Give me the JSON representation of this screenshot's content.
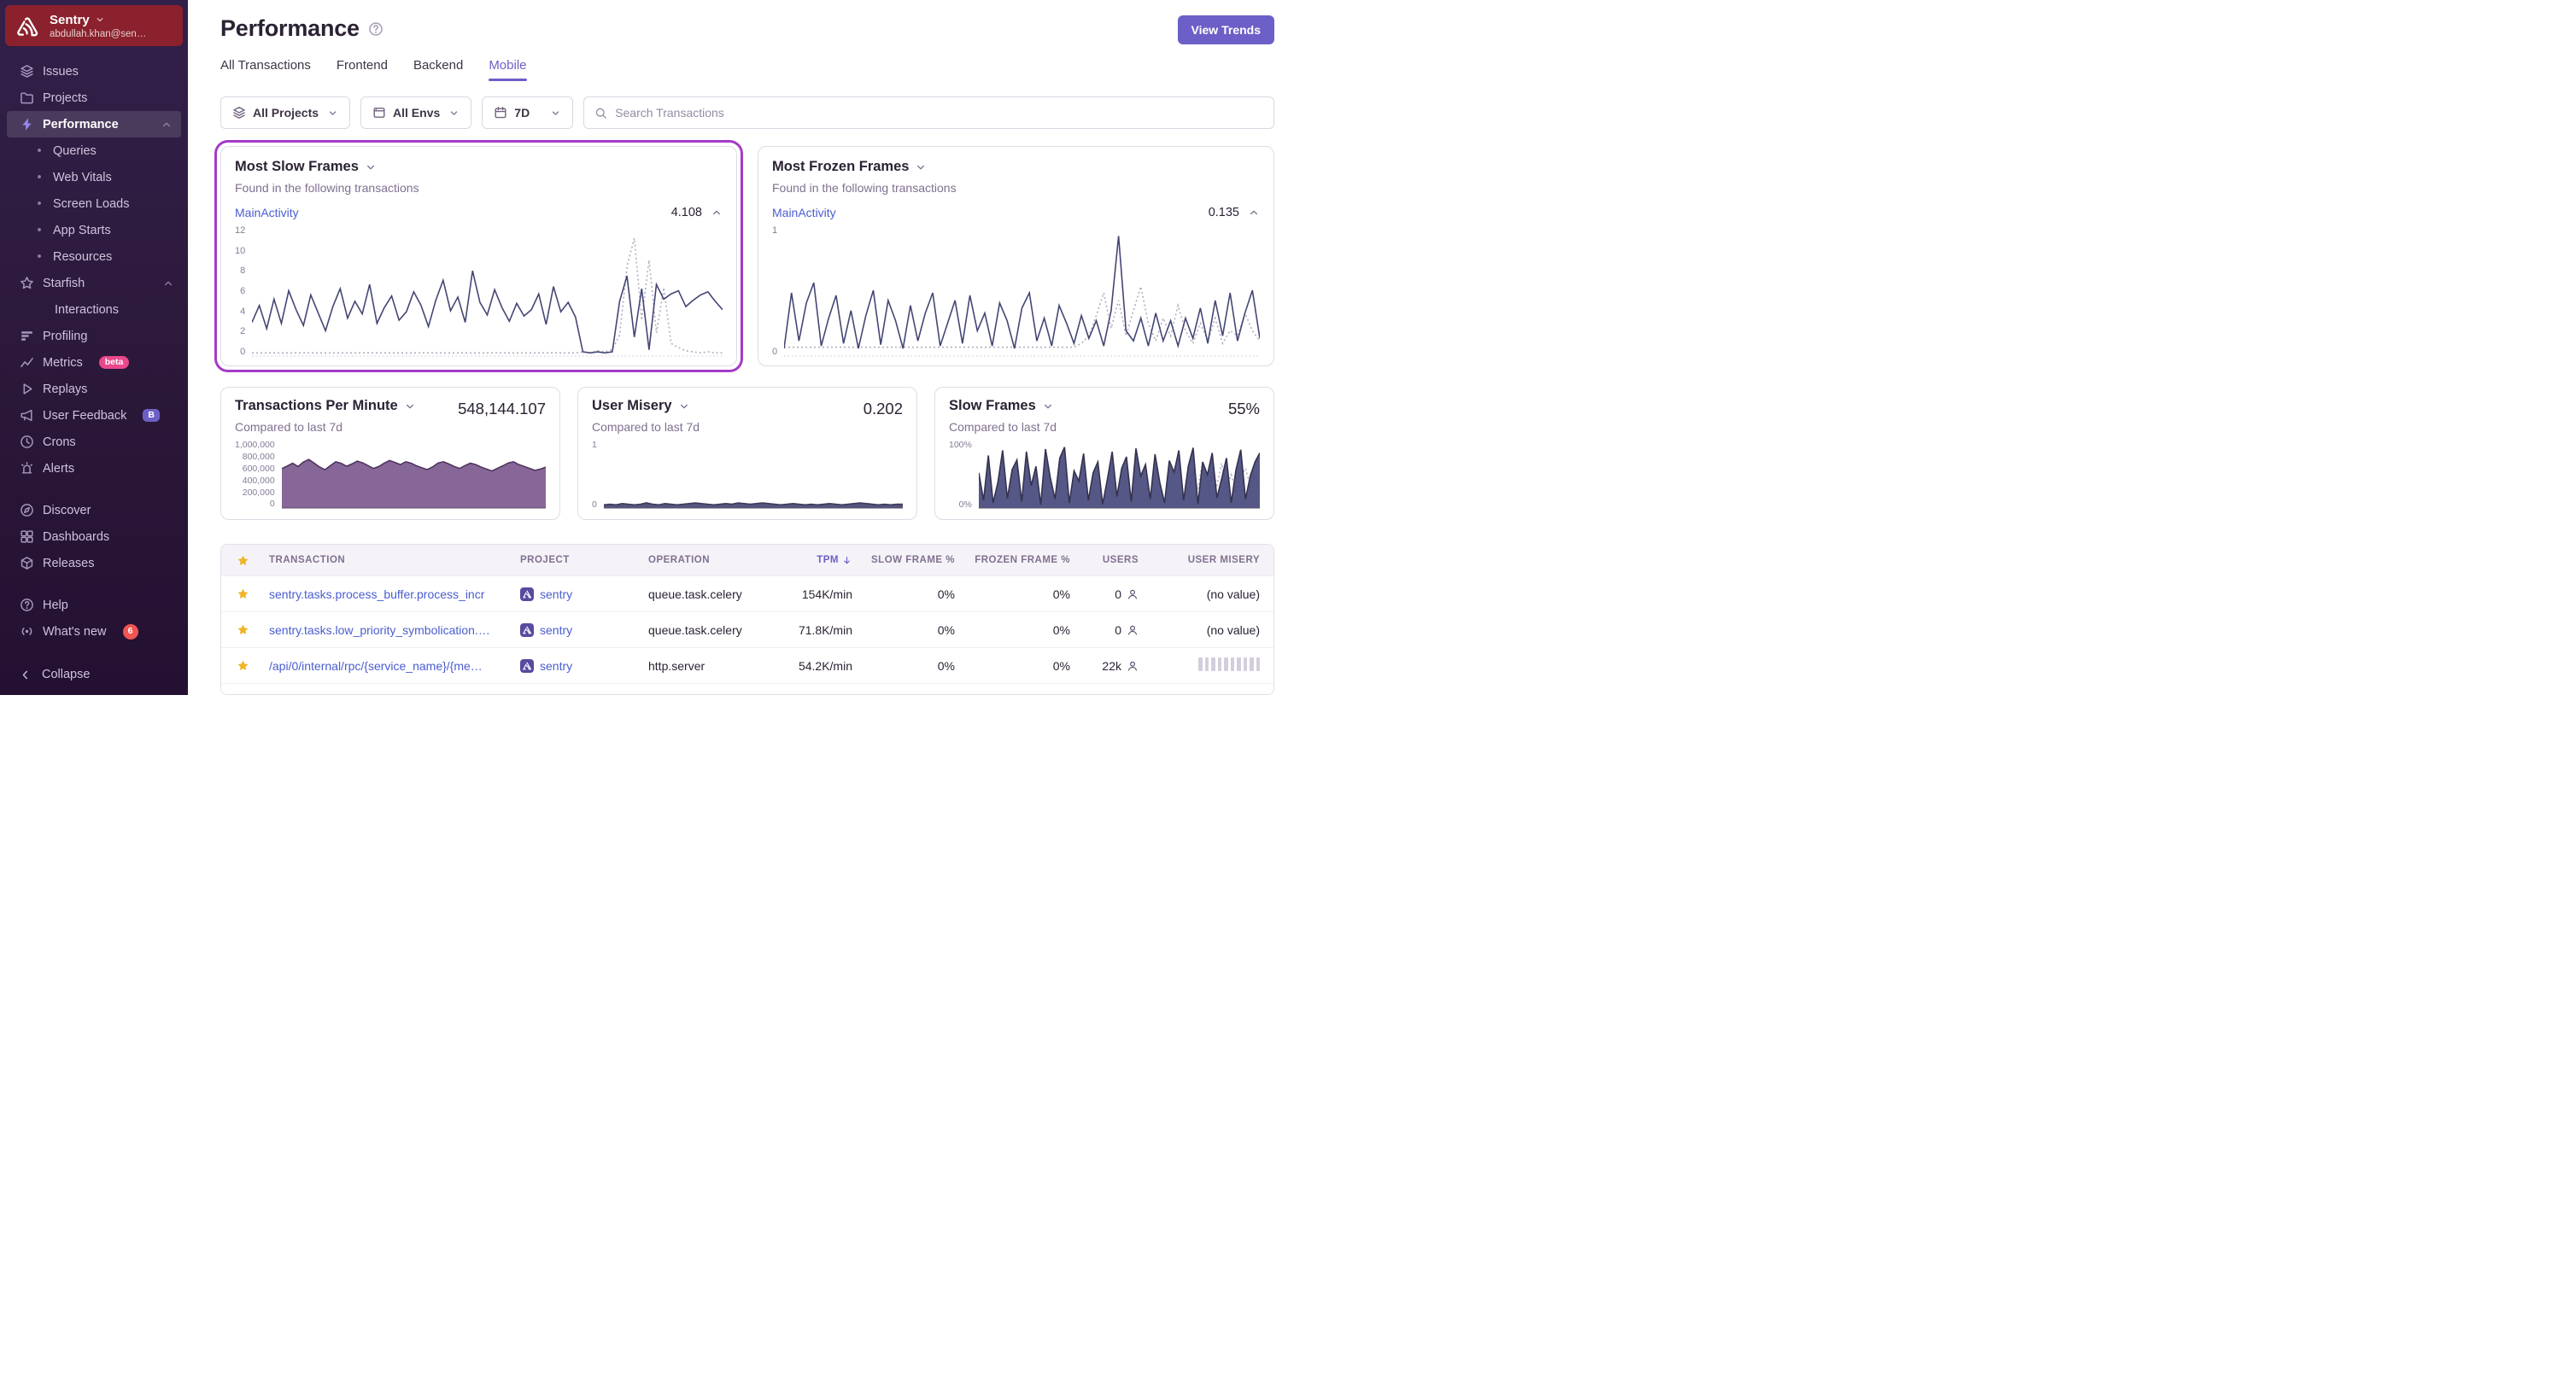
{
  "colors": {
    "accent": "#6c5fc7",
    "link": "#4a5dd0",
    "highlight": "#a43bc6",
    "star": "#f0b429",
    "chart_line": "#444674",
    "chart_comparison": "#b4acbe"
  },
  "sidebar": {
    "org": {
      "name": "Sentry",
      "email": "abdullah.khan@sen…"
    },
    "items": [
      {
        "label": "Issues",
        "icon": "issues-icon"
      },
      {
        "label": "Projects",
        "icon": "projects-icon"
      },
      {
        "label": "Performance",
        "icon": "performance-icon",
        "active": true,
        "expanded": true
      },
      {
        "label": "Queries",
        "type": "sub"
      },
      {
        "label": "Web Vitals",
        "type": "sub"
      },
      {
        "label": "Screen Loads",
        "type": "sub"
      },
      {
        "label": "App Starts",
        "type": "sub"
      },
      {
        "label": "Resources",
        "type": "sub"
      },
      {
        "label": "Starfish",
        "icon": "starfish-icon",
        "expanded": true
      },
      {
        "label": "Interactions",
        "type": "sub-plain"
      },
      {
        "label": "Profiling",
        "icon": "profiling-icon"
      },
      {
        "label": "Metrics",
        "icon": "metrics-icon",
        "badge": {
          "text": "beta",
          "type": "pill-pink"
        }
      },
      {
        "label": "Replays",
        "icon": "replays-icon"
      },
      {
        "label": "User Feedback",
        "icon": "user-feedback-icon",
        "badge": {
          "text": "B",
          "type": "pill-purple"
        }
      },
      {
        "label": "Crons",
        "icon": "crons-icon"
      },
      {
        "label": "Alerts",
        "icon": "alerts-icon"
      },
      {
        "type": "gap"
      },
      {
        "label": "Discover",
        "icon": "discover-icon"
      },
      {
        "label": "Dashboards",
        "icon": "dashboards-icon"
      },
      {
        "label": "Releases",
        "icon": "releases-icon"
      },
      {
        "type": "gap"
      },
      {
        "label": "Help",
        "icon": "help-icon"
      },
      {
        "label": "What's new",
        "icon": "whats-new-icon",
        "badge": {
          "text": "6",
          "type": "round-red"
        }
      }
    ],
    "collapse_label": "Collapse"
  },
  "header": {
    "title": "Performance",
    "view_trends_label": "View Trends"
  },
  "tabs": [
    {
      "label": "All Transactions",
      "active": false
    },
    {
      "label": "Frontend",
      "active": false
    },
    {
      "label": "Backend",
      "active": false
    },
    {
      "label": "Mobile",
      "active": true
    }
  ],
  "filters": {
    "projects_label": "All Projects",
    "envs_label": "All Envs",
    "date_label": "7D",
    "search_placeholder": "Search Transactions"
  },
  "chart_data": [
    {
      "id": "most-slow-frames",
      "type": "line",
      "title": "Most Slow Frames",
      "subtitle": "Found in the following transactions",
      "transaction": "MainActivity",
      "value": "4.108",
      "ylim": [
        0,
        12
      ],
      "yticks": [
        "12",
        "10",
        "8",
        "6",
        "4",
        "2",
        "0"
      ],
      "legend": "none",
      "grid": "baseline-only",
      "series": [
        {
          "name": "MainActivity",
          "color": "#444674",
          "values": [
            3.2,
            4.8,
            2.6,
            5.4,
            3.1,
            6.2,
            4.4,
            2.9,
            5.8,
            4.1,
            2.4,
            4.7,
            6.4,
            3.6,
            5.2,
            4,
            6.8,
            3.1,
            4.6,
            5.7,
            3.4,
            4.2,
            6.1,
            4.8,
            2.8,
            5.3,
            7.2,
            4.3,
            5.6,
            3.2,
            8.1,
            5.1,
            3.9,
            6.3,
            4.6,
            3.3,
            5,
            3.8,
            4.4,
            5.9,
            3,
            6.6,
            4.2,
            5.1,
            3.7,
            0.4,
            0.3,
            0.4,
            0.3,
            0.4,
            5.2,
            7.6,
            1.8,
            6.4,
            0.6,
            6.8,
            5.4,
            5.9,
            6.2,
            4.7,
            5.3,
            5.8,
            6.1,
            5.2,
            4.4
          ]
        },
        {
          "name": "previous period",
          "color": "#b4acbe",
          "style": "dotted",
          "values": [
            0.3,
            0.3,
            0.3,
            0.3,
            0.3,
            0.3,
            0.3,
            0.3,
            0.3,
            0.3,
            0.3,
            0.3,
            0.3,
            0.3,
            0.3,
            0.3,
            0.3,
            0.3,
            0.3,
            0.3,
            0.3,
            0.3,
            0.3,
            0.3,
            0.3,
            0.3,
            0.3,
            0.3,
            0.3,
            0.3,
            0.3,
            0.3,
            0.3,
            0.3,
            0.3,
            0.3,
            0.3,
            0.3,
            0.3,
            0.3,
            0.3,
            0.3,
            0.3,
            0.3,
            0.3,
            0.4,
            0.3,
            0.5,
            0.4,
            0.6,
            2,
            8.5,
            11.2,
            3.4,
            9.1,
            2.2,
            6.5,
            1.2,
            0.8,
            0.5,
            0.4,
            0.3,
            0.4,
            0.3,
            0.3
          ]
        }
      ]
    },
    {
      "id": "most-frozen-frames",
      "type": "line",
      "title": "Most Frozen Frames",
      "subtitle": "Found in the following transactions",
      "transaction": "MainActivity",
      "value": "0.135",
      "ylim": [
        0,
        1
      ],
      "yticks": [
        "1",
        "0"
      ],
      "legend": "none",
      "grid": "baseline-only",
      "series": [
        {
          "name": "MainActivity",
          "color": "#444674",
          "values": [
            0.06,
            0.5,
            0.12,
            0.42,
            0.58,
            0.08,
            0.3,
            0.48,
            0.1,
            0.36,
            0.06,
            0.32,
            0.52,
            0.09,
            0.44,
            0.28,
            0.06,
            0.4,
            0.12,
            0.34,
            0.5,
            0.08,
            0.26,
            0.44,
            0.1,
            0.48,
            0.2,
            0.34,
            0.08,
            0.42,
            0.28,
            0.06,
            0.38,
            0.5,
            0.12,
            0.3,
            0.08,
            0.4,
            0.26,
            0.1,
            0.32,
            0.14,
            0.28,
            0.08,
            0.36,
            0.95,
            0.2,
            0.12,
            0.3,
            0.08,
            0.34,
            0.12,
            0.28,
            0.08,
            0.3,
            0.14,
            0.38,
            0.1,
            0.44,
            0.16,
            0.5,
            0.12,
            0.34,
            0.52,
            0.14
          ]
        },
        {
          "name": "previous period",
          "color": "#b4acbe",
          "style": "dotted",
          "values": [
            0.07,
            0.07,
            0.07,
            0.07,
            0.07,
            0.07,
            0.07,
            0.07,
            0.07,
            0.07,
            0.07,
            0.07,
            0.07,
            0.07,
            0.07,
            0.07,
            0.07,
            0.07,
            0.07,
            0.07,
            0.07,
            0.07,
            0.07,
            0.07,
            0.07,
            0.07,
            0.07,
            0.07,
            0.07,
            0.07,
            0.07,
            0.07,
            0.07,
            0.07,
            0.07,
            0.07,
            0.07,
            0.07,
            0.07,
            0.07,
            0.1,
            0.16,
            0.32,
            0.5,
            0.22,
            0.44,
            0.16,
            0.36,
            0.55,
            0.26,
            0.12,
            0.3,
            0.16,
            0.4,
            0.2,
            0.1,
            0.26,
            0.12,
            0.3,
            0.1,
            0.2,
            0.16,
            0.34,
            0.2,
            0.12
          ]
        }
      ]
    },
    {
      "id": "transactions-per-minute",
      "type": "area",
      "title": "Transactions Per Minute",
      "subtitle": "Compared to last 7d",
      "value": "548,144.107",
      "ylim": [
        0,
        1000000
      ],
      "yticks": [
        "1,000,000",
        "800,000",
        "600,000",
        "400,000",
        "200,000",
        "0"
      ],
      "legend": "none",
      "series": [
        {
          "name": "TPM",
          "color": "#4f3560",
          "fill": "#7d5a8e",
          "values": [
            615000,
            655000,
            700000,
            648000,
            718000,
            758000,
            702000,
            640000,
            598000,
            662000,
            722000,
            698000,
            652000,
            688000,
            732000,
            705000,
            662000,
            618000,
            648000,
            700000,
            742000,
            712000,
            678000,
            722000,
            700000,
            658000,
            628000,
            600000,
            642000,
            702000,
            722000,
            688000,
            648000,
            618000,
            662000,
            700000,
            678000,
            638000,
            608000,
            578000,
            618000,
            658000,
            702000,
            722000,
            678000,
            648000,
            618000,
            588000,
            608000,
            638000
          ]
        }
      ]
    },
    {
      "id": "user-misery",
      "type": "area",
      "title": "User Misery",
      "subtitle": "Compared to last 7d",
      "value": "0.202",
      "ylim": [
        0,
        1
      ],
      "yticks": [
        "1",
        "0"
      ],
      "legend": "none",
      "series": [
        {
          "name": "User Misery",
          "color": "#3c3858",
          "fill": "#444674",
          "values": [
            0.05,
            0.06,
            0.05,
            0.07,
            0.06,
            0.05,
            0.06,
            0.08,
            0.06,
            0.05,
            0.07,
            0.06,
            0.05,
            0.06,
            0.07,
            0.08,
            0.07,
            0.06,
            0.05,
            0.06,
            0.07,
            0.06,
            0.08,
            0.07,
            0.06,
            0.07,
            0.08,
            0.07,
            0.06,
            0.05,
            0.06,
            0.07,
            0.06,
            0.05,
            0.06,
            0.05,
            0.06,
            0.07,
            0.06,
            0.05,
            0.06,
            0.07,
            0.08,
            0.07,
            0.06,
            0.05,
            0.06,
            0.05,
            0.06,
            0.06
          ]
        }
      ]
    },
    {
      "id": "slow-frames",
      "type": "area",
      "title": "Slow Frames",
      "subtitle": "Compared to last 7d",
      "value": "55%",
      "ylim": [
        0,
        100
      ],
      "yticks": [
        "100%",
        "0%"
      ],
      "legend": "none",
      "series": [
        {
          "name": "Slow Frames",
          "color": "#34324f",
          "fill": "#474a7c",
          "values": [
            55,
            12,
            82,
            8,
            40,
            90,
            15,
            60,
            75,
            10,
            88,
            35,
            65,
            5,
            92,
            48,
            14,
            78,
            95,
            8,
            58,
            42,
            85,
            12,
            55,
            72,
            6,
            45,
            88,
            18,
            62,
            80,
            10,
            93,
            50,
            68,
            14,
            84,
            40,
            8,
            74,
            56,
            90,
            12,
            66,
            94,
            6,
            72,
            52,
            86,
            16,
            46,
            78,
            8,
            60,
            91,
            14,
            50,
            72,
            86
          ]
        },
        {
          "name": "previous period",
          "color": "#b4acbe",
          "style": "dotted",
          "values": [
            null,
            null,
            null,
            null,
            null,
            null,
            null,
            null,
            null,
            null,
            null,
            null,
            null,
            null,
            null,
            null,
            null,
            null,
            null,
            null,
            null,
            null,
            null,
            null,
            null,
            null,
            null,
            null,
            null,
            null,
            null,
            null,
            null,
            null,
            null,
            null,
            null,
            null,
            null,
            null,
            null,
            null,
            null,
            null,
            25,
            60,
            30,
            72,
            28,
            58,
            36,
            70,
            30,
            52,
            26,
            48,
            62,
            34,
            50,
            30
          ]
        }
      ]
    }
  ],
  "table": {
    "columns": [
      "TRANSACTION",
      "PROJECT",
      "OPERATION",
      "TPM",
      "SLOW FRAME %",
      "FROZEN FRAME %",
      "USERS",
      "USER MISERY"
    ],
    "sorted_column": "TPM",
    "sort_direction": "desc",
    "rows": [
      {
        "transaction": "sentry.tasks.process_buffer.process_incr",
        "project": "sentry",
        "operation": "queue.task.celery",
        "tpm": "154K/min",
        "slow": "0%",
        "frozen": "0%",
        "users": "0",
        "misery": "(no value)",
        "misery_type": "text"
      },
      {
        "transaction": "sentry.tasks.low_priority_symbolication.…",
        "project": "sentry",
        "operation": "queue.task.celery",
        "tpm": "71.8K/min",
        "slow": "0%",
        "frozen": "0%",
        "users": "0",
        "misery": "(no value)",
        "misery_type": "text"
      },
      {
        "transaction": "/api/0/internal/rpc/{service_name}/{me…",
        "project": "sentry",
        "operation": "http.server",
        "tpm": "54.2K/min",
        "slow": "0%",
        "frozen": "0%",
        "users": "22k",
        "misery": "",
        "misery_type": "bars"
      },
      {
        "transaction": "",
        "project": "",
        "operation": "",
        "tpm": "",
        "slow": "",
        "frozen": "",
        "users": "",
        "misery": "",
        "misery_type": "none",
        "partial": true
      }
    ]
  }
}
